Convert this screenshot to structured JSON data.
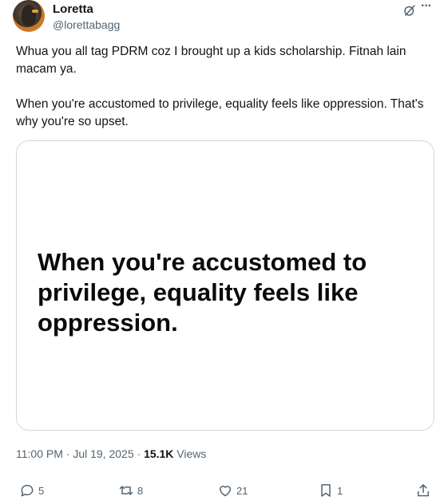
{
  "author": {
    "name": "Loretta",
    "handle": "@lorettabagg"
  },
  "tweet": {
    "paragraph_1": "Whua you all tag PDRM coz I brought up a kids scholarship. Fitnah lain macam ya.",
    "paragraph_2": "When you're accustomed to privilege, equality feels like oppression. That's why you're so upset."
  },
  "media": {
    "text": "When you're accustomed to privilege, equality feels like oppression."
  },
  "meta": {
    "timestamp": "11:00 PM · Jul 19, 2025 · ",
    "views_count": "15.1K",
    "views_label": " Views"
  },
  "actions": {
    "replies": "5",
    "reposts": "8",
    "likes": "21",
    "bookmarks": "1"
  },
  "icons": {
    "grok": "grok-icon",
    "more": "more-icon",
    "reply": "reply-icon",
    "repost": "repost-icon",
    "like": "heart-icon",
    "bookmark": "bookmark-icon",
    "share": "share-icon"
  }
}
